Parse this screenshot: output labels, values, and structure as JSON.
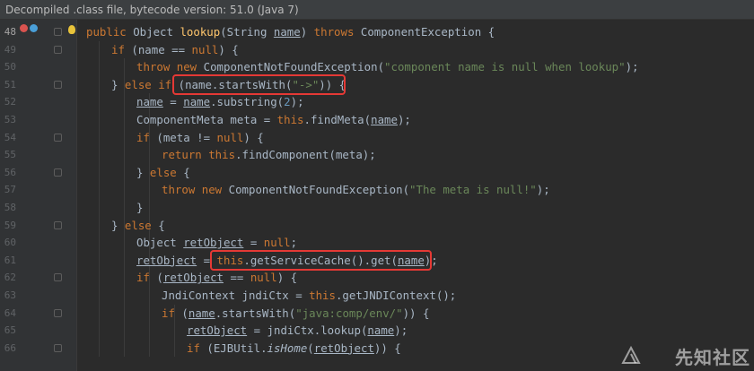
{
  "banner": {
    "text": "Decompiled .class file, bytecode version: 51.0 (Java 7)"
  },
  "watermark": {
    "text": "先知社区"
  },
  "colors": {
    "keyword": "#cc7832",
    "string": "#6a8759",
    "function": "#ffc66d",
    "number": "#6897bb",
    "highlight_box": "#e53935"
  },
  "lines": [
    {
      "no": "48",
      "tokens": [
        [
          "kw",
          "public "
        ],
        [
          "t",
          "Object "
        ],
        [
          "fn",
          "lookup"
        ],
        [
          "t",
          "(String "
        ],
        [
          "ul",
          "name"
        ],
        [
          "t",
          ") "
        ],
        [
          "kw",
          "throws "
        ],
        [
          "t",
          "ComponentException {"
        ]
      ]
    },
    {
      "no": "49",
      "tokens": [
        [
          "kw",
          "if "
        ],
        [
          "t",
          "(name == "
        ],
        [
          "kw",
          "null"
        ],
        [
          "t",
          ") {"
        ]
      ]
    },
    {
      "no": "50",
      "tokens": [
        [
          "kw",
          "throw new "
        ],
        [
          "t",
          "ComponentNotFoundException("
        ],
        [
          "str",
          "\"component name is null when lookup\""
        ],
        [
          "t",
          ");"
        ]
      ]
    },
    {
      "no": "51",
      "tokens": [
        [
          "t",
          "} "
        ],
        [
          "kw",
          "else if "
        ],
        [
          "t",
          "(name.startsWith("
        ],
        [
          "str",
          "\"->\""
        ],
        [
          "t",
          ")) {"
        ]
      ]
    },
    {
      "no": "52",
      "tokens": [
        [
          "ul",
          "name"
        ],
        [
          "t",
          " = "
        ],
        [
          "ul",
          "name"
        ],
        [
          "t",
          ".substring("
        ],
        [
          "num",
          "2"
        ],
        [
          "t",
          ");"
        ]
      ]
    },
    {
      "no": "53",
      "tokens": [
        [
          "t",
          "ComponentMeta meta = "
        ],
        [
          "kw",
          "this"
        ],
        [
          "t",
          ".findMeta("
        ],
        [
          "ul",
          "name"
        ],
        [
          "t",
          ");"
        ]
      ]
    },
    {
      "no": "54",
      "tokens": [
        [
          "kw",
          "if "
        ],
        [
          "t",
          "(meta != "
        ],
        [
          "kw",
          "null"
        ],
        [
          "t",
          ") {"
        ]
      ]
    },
    {
      "no": "55",
      "tokens": [
        [
          "kw",
          "return this"
        ],
        [
          "t",
          ".findComponent(meta);"
        ]
      ]
    },
    {
      "no": "56",
      "tokens": [
        [
          "t",
          "} "
        ],
        [
          "kw",
          "else "
        ],
        [
          "t",
          "{"
        ]
      ]
    },
    {
      "no": "57",
      "tokens": [
        [
          "kw",
          "throw new "
        ],
        [
          "t",
          "ComponentNotFoundException("
        ],
        [
          "str",
          "\"The meta is null!\""
        ],
        [
          "t",
          ");"
        ]
      ]
    },
    {
      "no": "58",
      "tokens": [
        [
          "t",
          "}"
        ]
      ]
    },
    {
      "no": "59",
      "tokens": [
        [
          "t",
          "} "
        ],
        [
          "kw",
          "else "
        ],
        [
          "t",
          "{"
        ]
      ]
    },
    {
      "no": "60",
      "tokens": [
        [
          "t",
          "Object "
        ],
        [
          "ul",
          "retObject"
        ],
        [
          "t",
          " = "
        ],
        [
          "kw",
          "null"
        ],
        [
          "t",
          ";"
        ]
      ]
    },
    {
      "no": "61",
      "tokens": [
        [
          "ul",
          "retObject"
        ],
        [
          "t",
          " = "
        ],
        [
          "kw",
          "this"
        ],
        [
          "t",
          ".getServiceCache().get("
        ],
        [
          "ul",
          "name"
        ],
        [
          "t",
          ");"
        ]
      ]
    },
    {
      "no": "62",
      "tokens": [
        [
          "kw",
          "if "
        ],
        [
          "t",
          "("
        ],
        [
          "ul",
          "retObject"
        ],
        [
          "t",
          " == "
        ],
        [
          "kw",
          "null"
        ],
        [
          "t",
          ") {"
        ]
      ]
    },
    {
      "no": "63",
      "tokens": [
        [
          "t",
          "JndiContext jndiCtx = "
        ],
        [
          "kw",
          "this"
        ],
        [
          "t",
          ".getJNDIContext();"
        ]
      ]
    },
    {
      "no": "64",
      "tokens": [
        [
          "kw",
          "if "
        ],
        [
          "t",
          "("
        ],
        [
          "ul",
          "name"
        ],
        [
          "t",
          ".startsWith("
        ],
        [
          "str",
          "\"java:comp/env/\""
        ],
        [
          "t",
          ")) {"
        ]
      ]
    },
    {
      "no": "65",
      "tokens": [
        [
          "ul",
          "retObject"
        ],
        [
          "t",
          " = jndiCtx.lookup("
        ],
        [
          "ul",
          "name"
        ],
        [
          "t",
          ");"
        ]
      ]
    },
    {
      "no": "66",
      "tokens": [
        [
          "kw",
          "if "
        ],
        [
          "t",
          "(EJBUtil."
        ],
        [
          "ital",
          "isHome"
        ],
        [
          "t",
          "("
        ],
        [
          "ul",
          "retObject"
        ],
        [
          "t",
          ")) {"
        ]
      ]
    }
  ]
}
